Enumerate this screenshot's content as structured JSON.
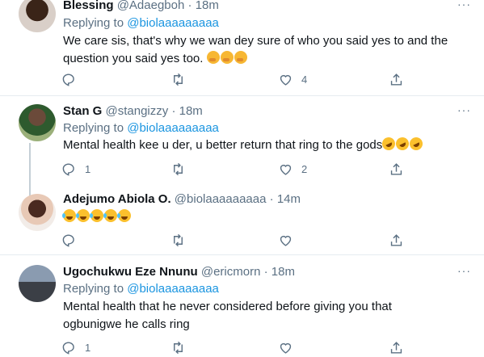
{
  "tweets": [
    {
      "name": "Blessing",
      "handle": "@Adaegboh",
      "time": "18m",
      "replying_prefix": "Replying to ",
      "replying_to": "@biolaaaaaaaaa",
      "text": "We care sis, that's why we wan dey sure of who you said yes to and the question you said yes too.",
      "emoji": [
        "thinking-face",
        "thinking-face",
        "thinking-face"
      ],
      "replies": "",
      "retweets": "",
      "likes": "4"
    },
    {
      "name": "Stan G",
      "handle": "@stangizzy",
      "time": "18m",
      "replying_prefix": "Replying to ",
      "replying_to": "@biolaaaaaaaaa",
      "text": "Mental health kee u der, u better return that ring to the gods",
      "emoji": [
        "rofl",
        "rofl",
        "rofl"
      ],
      "replies": "1",
      "retweets": "",
      "likes": "2"
    },
    {
      "name": "Adejumo Abiola O.",
      "handle": "@biolaaaaaaaaa",
      "time": "14m",
      "text": "",
      "emoji": [
        "tears-of-joy",
        "tears-of-joy",
        "tears-of-joy",
        "tears-of-joy",
        "tears-of-joy"
      ],
      "replies": "",
      "retweets": "",
      "likes": ""
    },
    {
      "name": "Ugochukwu Eze Nnunu",
      "handle": "@ericmorn",
      "time": "18m",
      "replying_prefix": "Replying to ",
      "replying_to": "@biolaaaaaaaaa",
      "text": "Mental health that he never considered before giving you that ogbunigwe he calls ring",
      "replies": "1",
      "retweets": "",
      "likes": ""
    }
  ],
  "separator": " · ",
  "more_glyph": "···"
}
